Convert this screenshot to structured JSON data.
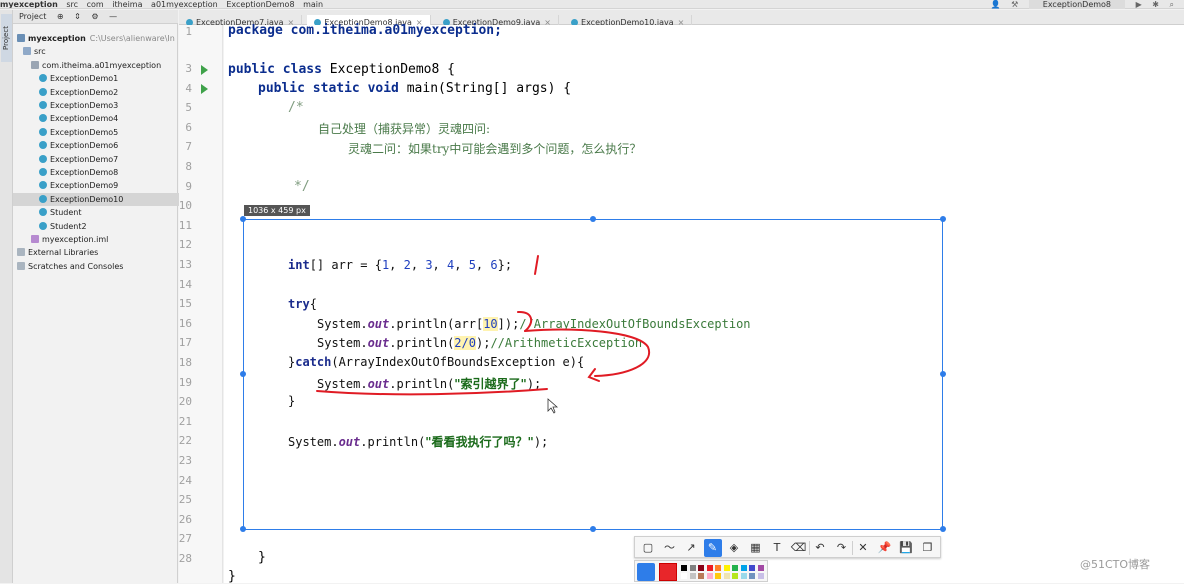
{
  "breadcrumb": {
    "items": [
      "myexception",
      "src",
      "com",
      "itheima",
      "a01myexception",
      "ExceptionDemo8",
      "main"
    ]
  },
  "nav_tools": {
    "run_config": "ExceptionDemo8"
  },
  "left_strip": {
    "project_tab": "Project"
  },
  "project_panel": {
    "header_label": "Project",
    "rows": [
      {
        "label": "myexception",
        "suffix": "C:\\Users\\alienware\\In",
        "icon": "module-icon"
      },
      {
        "label": "src",
        "suffix": "",
        "icon": "folder-icon"
      },
      {
        "label": "com.itheima.a01myexception",
        "suffix": "",
        "icon": "package-icon"
      },
      {
        "label": "ExceptionDemo1",
        "suffix": "",
        "icon": "class-icon"
      },
      {
        "label": "ExceptionDemo2",
        "suffix": "",
        "icon": "class-icon"
      },
      {
        "label": "ExceptionDemo3",
        "suffix": "",
        "icon": "class-icon"
      },
      {
        "label": "ExceptionDemo4",
        "suffix": "",
        "icon": "class-icon"
      },
      {
        "label": "ExceptionDemo5",
        "suffix": "",
        "icon": "class-icon"
      },
      {
        "label": "ExceptionDemo6",
        "suffix": "",
        "icon": "class-icon"
      },
      {
        "label": "ExceptionDemo7",
        "suffix": "",
        "icon": "class-icon"
      },
      {
        "label": "ExceptionDemo8",
        "suffix": "",
        "icon": "class-icon"
      },
      {
        "label": "ExceptionDemo9",
        "suffix": "",
        "icon": "class-icon"
      },
      {
        "label": "ExceptionDemo10",
        "suffix": "",
        "icon": "class-icon"
      },
      {
        "label": "Student",
        "suffix": "",
        "icon": "class-icon"
      },
      {
        "label": "Student2",
        "suffix": "",
        "icon": "class-icon"
      },
      {
        "label": "myexception.iml",
        "suffix": "",
        "icon": "iml-icon"
      },
      {
        "label": "External Libraries",
        "suffix": "",
        "icon": "library-icon"
      },
      {
        "label": "Scratches and Consoles",
        "suffix": "",
        "icon": "scratch-icon"
      }
    ]
  },
  "tabs": [
    {
      "label": "ExceptionDemo7.java"
    },
    {
      "label": "ExceptionDemo8.java"
    },
    {
      "label": "ExceptionDemo9.java"
    },
    {
      "label": "ExceptionDemo10.java"
    }
  ],
  "editor": {
    "line_numbers": [
      "1",
      "3",
      "4",
      "5",
      "6",
      "7",
      "8",
      "9",
      "10",
      "11",
      "12",
      "13",
      "14",
      "15",
      "16",
      "17",
      "18",
      "19",
      "20",
      "21",
      "22",
      "23",
      "24",
      "25",
      "26",
      "27",
      "28"
    ],
    "line1": "package com.itheima.a01myexception;",
    "class_kw": "public class",
    "class_name": " ExceptionDemo8 {",
    "main_kw": "public static void",
    "main_rest": " main(String[] args) {",
    "comment_open": "/*",
    "comment_line1": "自己处理（捕获异常）灵魂四问:",
    "comment_line2": "灵魂二问：如果try中可能会遇到多个问题，怎么执行？",
    "comment_close": "*/",
    "closing_brace_inner": "}",
    "closing_brace_outer": "}"
  },
  "capture": {
    "size_label": "1036 x 459  px",
    "l1_kw": "int",
    "l1_a": "[] arr = {",
    "l1_n1": "1",
    "l1_n2": "2",
    "l1_n3": "3",
    "l1_n4": "4",
    "l1_n5": "5",
    "l1_n6": "6",
    "l1_end": "};",
    "sep": ", ",
    "try_kw": "try",
    "brace_open": "{",
    "sys": "System.",
    "out": "out",
    "println_a": ".println(arr[",
    "idx": "10",
    "println_a_end": "]);",
    "cm1": "//ArrayIndexOutOfBoundsException",
    "println_b": ".println(",
    "div": "2/0",
    "println_b_end": ");",
    "cm2": "//ArithmeticException",
    "catch_a": "}",
    "catch_kw": "catch",
    "catch_rest": "(ArrayIndexOutOfBoundsException e){",
    "println_c": ".println(",
    "str1": "\"索引越界了\"",
    "close_paren": ");",
    "brace_close": "}",
    "str2": "\"看看我执行了吗？\""
  },
  "toolbar": {
    "buttons": [
      "rectangle-tool-icon",
      "curve-tool-icon",
      "arrow-tool-icon",
      "pen-tool-icon",
      "marker-tool-icon",
      "mosaic-tool-icon",
      "text-tool-icon",
      "eraser-tool-icon",
      "undo-icon",
      "redo-icon",
      "close-icon",
      "pin-icon",
      "save-icon",
      "copy-icon"
    ],
    "glyphs": [
      "▢",
      "〜",
      "↗",
      "✎",
      "◈",
      "▦",
      "T",
      "⌫",
      "↶",
      "↷",
      "✕",
      "📌",
      "💾",
      "❐"
    ]
  },
  "colors": {
    "accent": "#2e7de9",
    "current": "#e8262a",
    "swatches": [
      "#000000",
      "#7f7f7f",
      "#880015",
      "#ed1c24",
      "#ff7f27",
      "#fff200",
      "#22b14c",
      "#00a2e8",
      "#3f48cc",
      "#a349a4",
      "#ffffff",
      "#c3c3c3",
      "#b97a57",
      "#ffaec9",
      "#ffc90e",
      "#efe4b0",
      "#b5e61d",
      "#99d9ea",
      "#7092be",
      "#c8bfe7"
    ]
  },
  "watermark": "@51CTO博客"
}
